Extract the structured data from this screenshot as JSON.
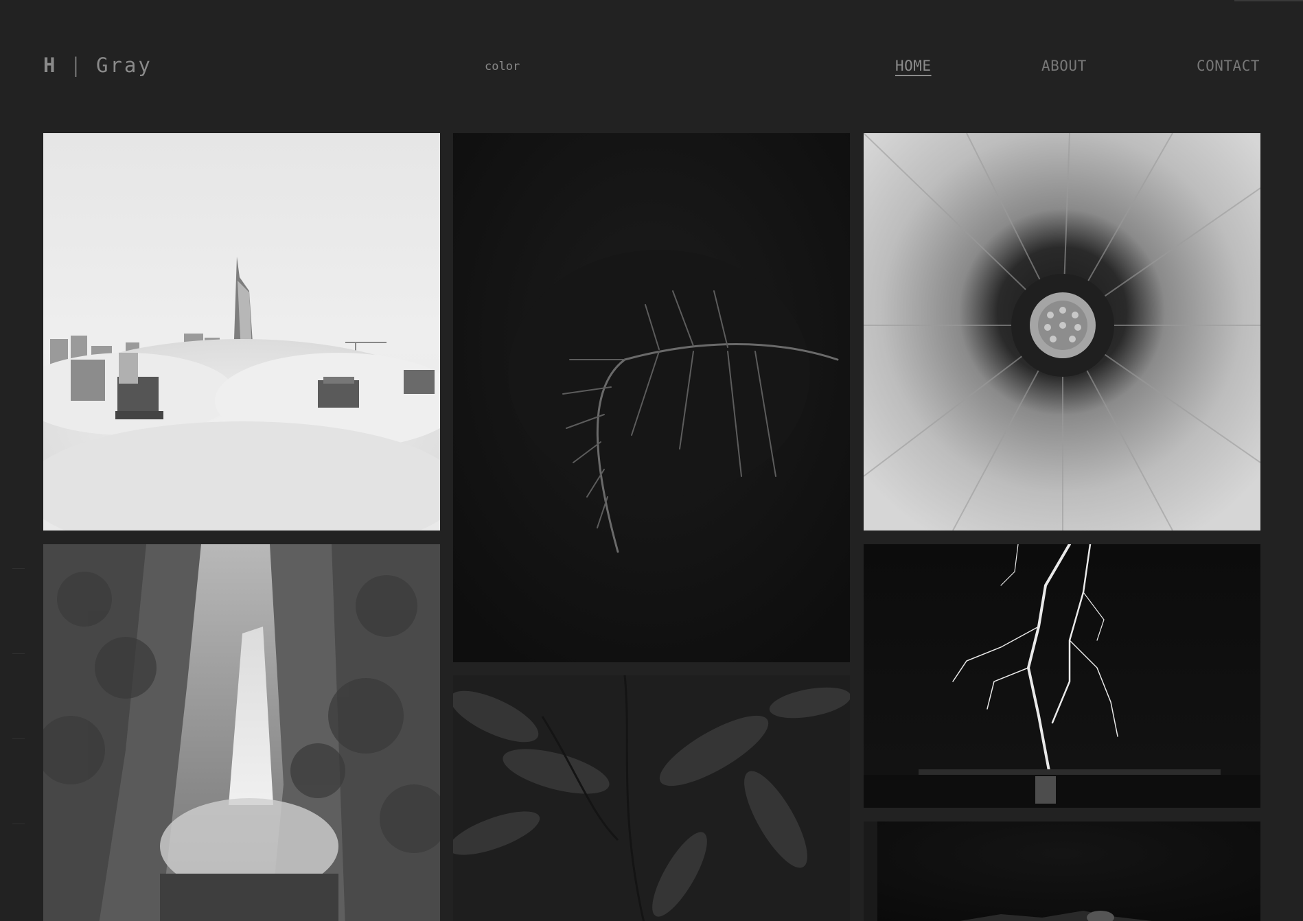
{
  "header": {
    "logo_mark": "H",
    "logo_separator": "|",
    "logo_name": "Gray",
    "color_toggle": "color"
  },
  "nav": {
    "items": [
      {
        "label": "HOME",
        "active": true
      },
      {
        "label": "ABOUT",
        "active": false
      },
      {
        "label": "CONTACT",
        "active": false
      }
    ]
  },
  "gallery": {
    "photos": [
      {
        "subject": "city-skyline-above-clouds"
      },
      {
        "subject": "fern-frond-dark"
      },
      {
        "subject": "daisy-flower-closeup"
      },
      {
        "subject": "waterfall-in-forest"
      },
      {
        "subject": "lightning-over-water"
      },
      {
        "subject": "dark-leaves"
      },
      {
        "subject": "dark-landscape-partial"
      }
    ]
  },
  "colors": {
    "background": "#222222",
    "nav_text": "#777777",
    "logo_text": "#8a8a8a"
  }
}
